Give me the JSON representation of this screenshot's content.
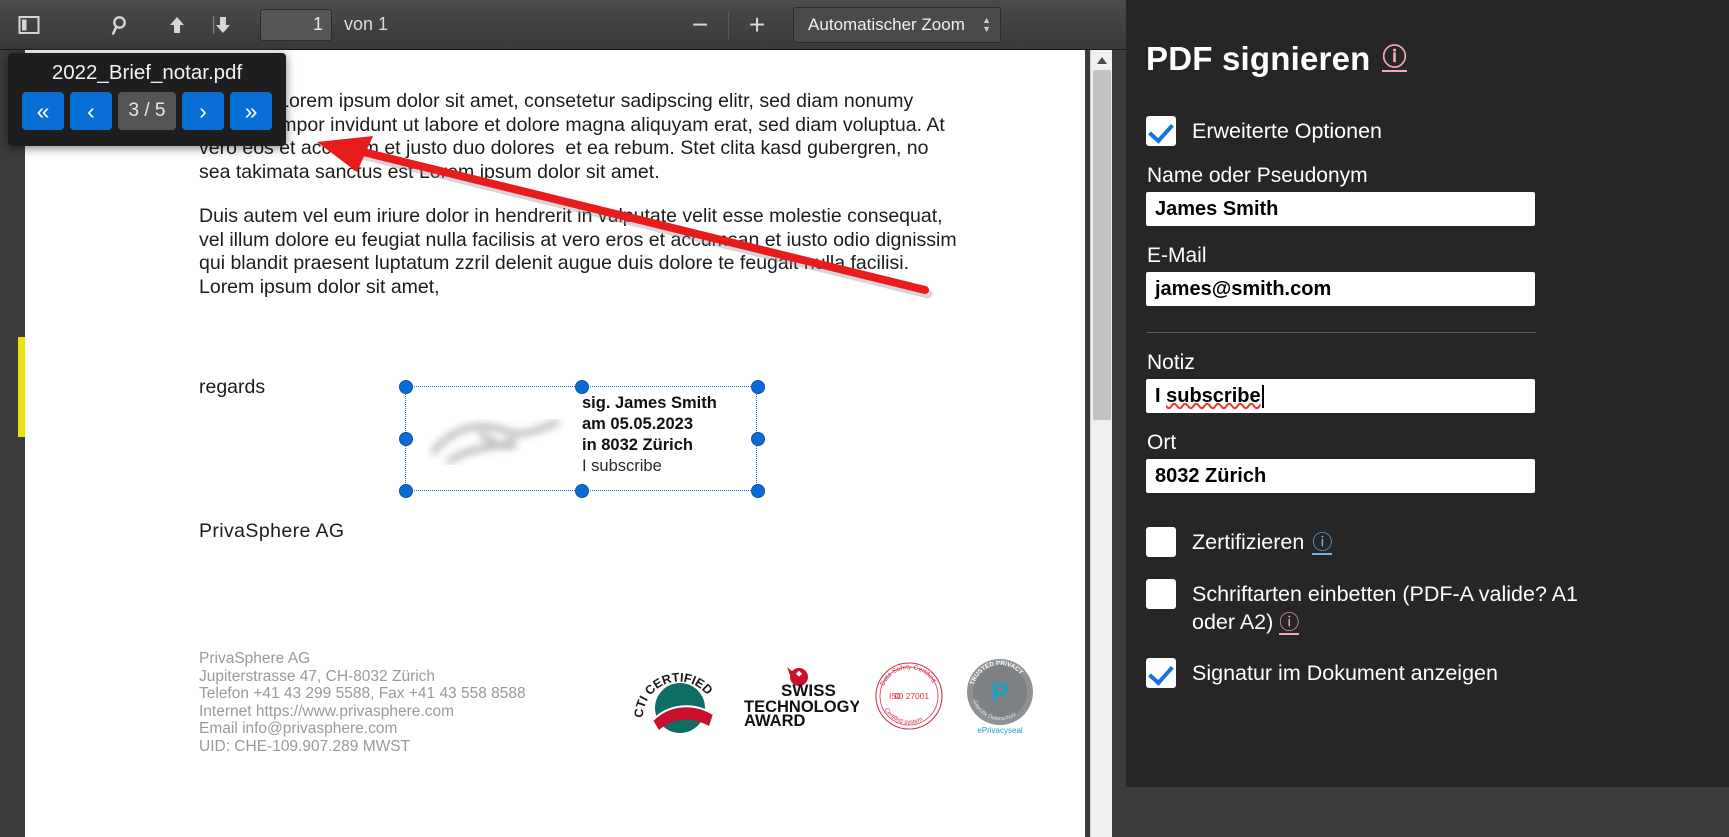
{
  "toolbar": {
    "sidebar_toggle_icon": "sidebar-toggle-icon",
    "search_icon": "search-icon",
    "prev_page_icon": "arrow-up-icon",
    "next_page_icon": "arrow-down-icon",
    "page_number": "1",
    "page_total_label": "von 1",
    "zoom_out_label": "−",
    "zoom_in_label": "+",
    "zoom_select_value": "Automatischer Zoom",
    "open_file_icon": "open-file-upload-icon"
  },
  "file_overlay": {
    "file_name": "2022_Brief_notar.pdf",
    "first_label": "«",
    "prev_label": "‹",
    "counter": "3 / 5",
    "next_label": "›",
    "last_label": "»"
  },
  "document": {
    "paragraph_1": "sit amet. Lorem ipsum dolor sit amet, consetetur sadipscing elitr, sed diam nonumy\neirmod tempor invidunt ut labore et dolore magna aliquyam erat, sed diam voluptua. At\nvero eos et accusam et justo duo dolores  et ea rebum. Stet clita kasd gubergren, no\nsea takimata sanctus est Lorem ipsum dolor sit amet.",
    "paragraph_2": "Duis autem vel eum iriure dolor in hendrerit in vulputate velit esse molestie consequat,\nvel illum dolore eu feugiat nulla facilisis at vero eros et accumsan et iusto odio dignissim\nqui blandit praesent luptatum zzril delenit augue duis dolore te feugait nulla facilisi.\nLorem ipsum dolor sit amet,",
    "regards": "regards",
    "company": "PrivaSphere AG",
    "signature": {
      "line_1": "sig. James Smith",
      "line_2": "am 05.05.2023",
      "line_3": "in 8032 Zürich",
      "note": "I subscribe"
    },
    "footer_address": "PrivaSphere AG\nJupiterstrasse 47, CH-8032 Zürich\nTelefon +41 43 299 5588,  Fax +41 43 558 8588\nInternet https://www.privasphere.com\nEmail info@privasphere.com\nUID: CHE-109.907.289  MWST",
    "logos": [
      {
        "name": "cti-certified-logo",
        "text": "CTI CERTIFIED"
      },
      {
        "name": "swiss-technology-award-logo",
        "text": "SWISS TECHNOLOGY AWARD"
      },
      {
        "name": "iso-27001-seal-logo",
        "text": "ISO 27001"
      },
      {
        "name": "eprivacyseal-trusted-privacy-logo",
        "text": "ePrivacyseal"
      }
    ]
  },
  "sign_panel": {
    "title": "PDF signieren",
    "title_info_icon": "info-icon",
    "advanced_options_label": "Erweiterte Optionen",
    "advanced_options_checked": true,
    "name_label": "Name oder Pseudonym",
    "name_value": "James Smith",
    "email_label": "E-Mail",
    "email_value": "james@smith.com",
    "note_label": "Notiz",
    "note_value_word1": "I",
    "note_value_word2": "subscribe",
    "place_label": "Ort",
    "place_value": "8032 Zürich",
    "certify_label": "Zertifizieren",
    "certify_checked": false,
    "embed_fonts_label": "Schriftarten einbetten (PDF-A valide? A1 oder A2)",
    "embed_fonts_checked": false,
    "show_signature_label": "Signatur im Dokument anzeigen",
    "show_signature_checked": true
  },
  "colors": {
    "toolbar_bg": "#424242",
    "panel_bg": "#262626",
    "accent_blue": "#0a6fd4",
    "checkbox_check": "#1473e6",
    "annotation_red": "#e81c1c",
    "marker_yellow": "#ece20d",
    "info_pink": "#f7a8b8",
    "info_blue": "#6fb4e8"
  }
}
